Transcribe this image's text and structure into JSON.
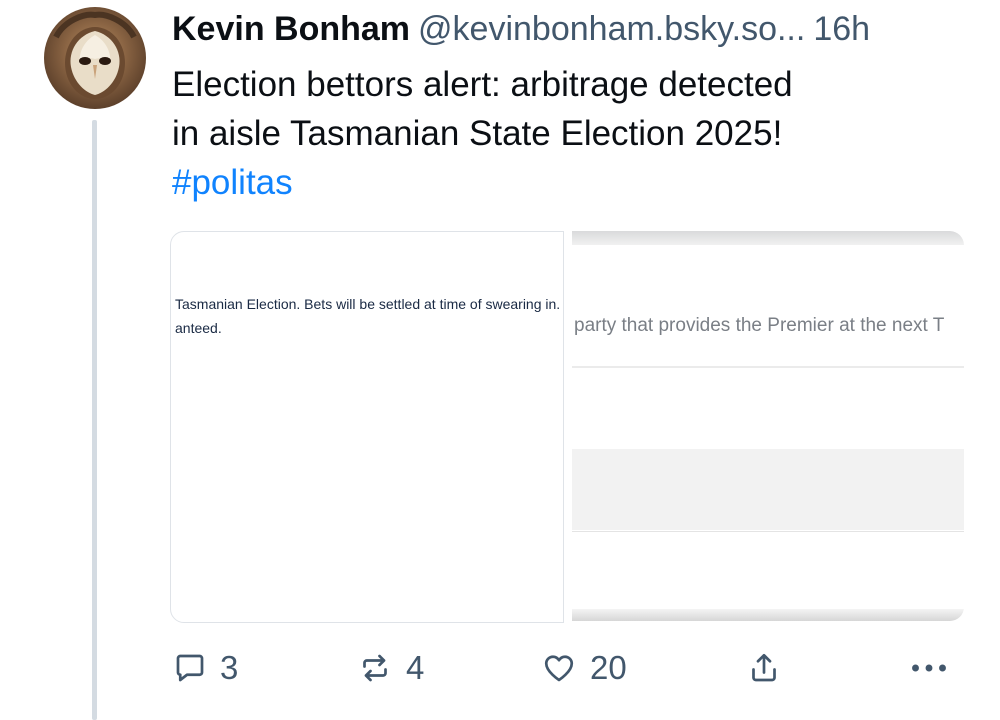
{
  "author": {
    "display_name": "Kevin Bonham",
    "handle": "@kevinbonham.bsky.so...",
    "time": "16h"
  },
  "post": {
    "line1": "Election bettors alert: arbitrage detected",
    "line2": "in aisle Tasmanian State Election 2025!",
    "hashtag": "#politas"
  },
  "images": {
    "left": {
      "line1": "Tasmanian Election. Bets will be settled at time of swearing in.",
      "line2": "anteed."
    },
    "right": {
      "text": "party that provides the Premier at the next T"
    }
  },
  "actions": {
    "reply_count": "3",
    "repost_count": "4",
    "like_count": "20"
  },
  "colors": {
    "accent": "#1083fe",
    "secondary_text": "#42576c",
    "thread_line": "#d4dbe2"
  },
  "icons": [
    "reply-icon",
    "repost-icon",
    "like-icon",
    "share-icon",
    "more-icon"
  ]
}
